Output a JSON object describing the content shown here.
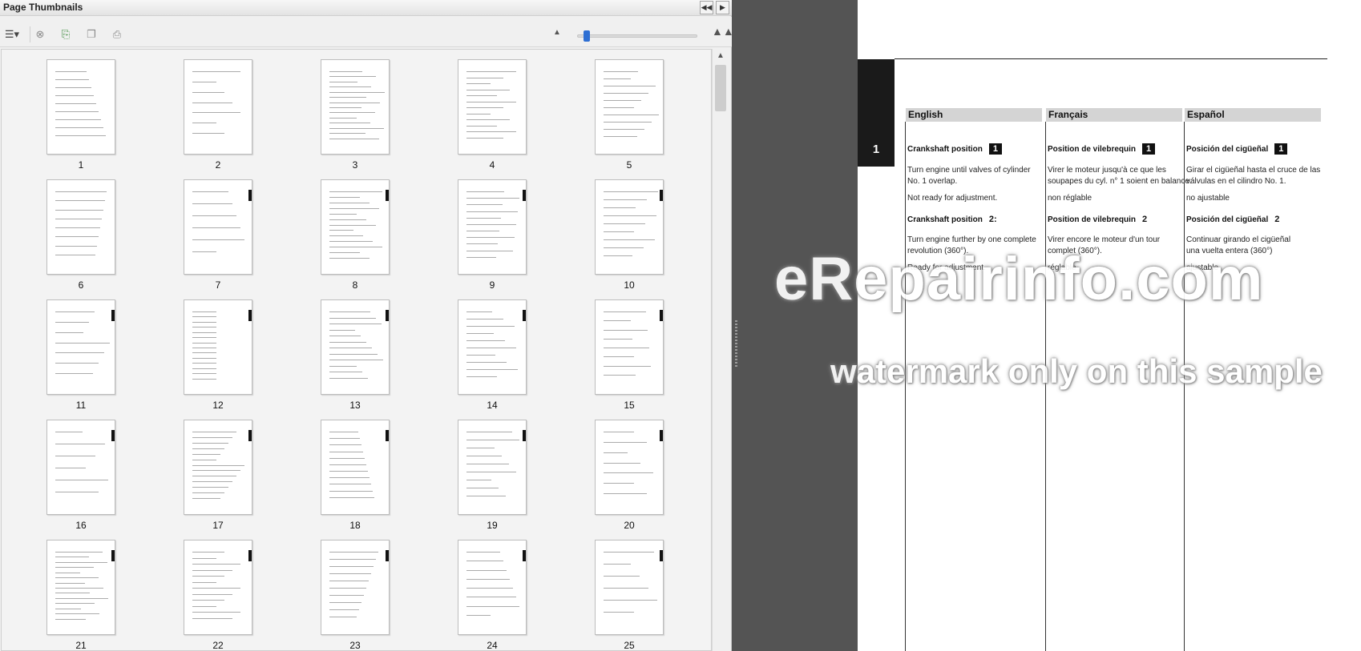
{
  "panel": {
    "title": "Page Thumbnails",
    "header_buttons": [
      "collapse-left-icon",
      "expand-right-icon"
    ],
    "toolbar_icons": [
      "options-menu-icon",
      "delete-pages-icon",
      "insert-pages-icon",
      "replace-pages-icon",
      "print-pages-icon",
      "zoom-out-mountain-icon",
      "zoom-in-mountain-icon"
    ],
    "zoom_level": 0.05
  },
  "thumbnails": [
    {
      "num": "1"
    },
    {
      "num": "2"
    },
    {
      "num": "3"
    },
    {
      "num": "4"
    },
    {
      "num": "5"
    },
    {
      "num": "6"
    },
    {
      "num": "7"
    },
    {
      "num": "8"
    },
    {
      "num": "9"
    },
    {
      "num": "10"
    },
    {
      "num": "11"
    },
    {
      "num": "12"
    },
    {
      "num": "13"
    },
    {
      "num": "14"
    },
    {
      "num": "15"
    },
    {
      "num": "16"
    },
    {
      "num": "17"
    },
    {
      "num": "18"
    },
    {
      "num": "19"
    },
    {
      "num": "20"
    },
    {
      "num": "21"
    },
    {
      "num": "22"
    },
    {
      "num": "23"
    },
    {
      "num": "24"
    },
    {
      "num": "25"
    }
  ],
  "document": {
    "tab_number": "1",
    "columns": [
      {
        "heading": "English",
        "pos1_title": "Crankshaft position",
        "pos1_badge": "1",
        "pos1_line1": "Turn engine until valves of cylinder",
        "pos1_line2": "No. 1 overlap.",
        "pos1_note": "Not ready for adjustment.",
        "pos2_title": "Crankshaft position",
        "pos2_num": "2:",
        "pos2_line1": "Turn engine further by one complete",
        "pos2_line2": "revolution (360°).",
        "pos2_note": "Ready for adjustment."
      },
      {
        "heading": "Français",
        "pos1_title": "Position de vilebrequin",
        "pos1_badge": "1",
        "pos1_line1": "Virer le moteur jusqu'à ce que les",
        "pos1_line2": "soupapes du cyl. n° 1 soient en balance.",
        "pos1_note": "non réglable",
        "pos2_title": "Position de vilebrequin",
        "pos2_num": "2",
        "pos2_line1": "Virer encore le moteur d'un tour",
        "pos2_line2": "complet (360°).",
        "pos2_note": "réglable"
      },
      {
        "heading": "Español",
        "pos1_title": "Posición del cigüeñal",
        "pos1_badge": "1",
        "pos1_line1": "Girar el cigüeñal hasta el cruce de las",
        "pos1_line2": "válvulas en el cilindro No. 1.",
        "pos1_note": "no ajustable",
        "pos2_title": "Posición del cigüeñal",
        "pos2_num": "2",
        "pos2_line1": "Continuar girando el cigüeñal",
        "pos2_line2": "una vuelta entera (360°)",
        "pos2_note": "ajustable"
      }
    ]
  },
  "watermark": {
    "line1": "eRepairinfo.com",
    "line2": "watermark only on this sample"
  }
}
